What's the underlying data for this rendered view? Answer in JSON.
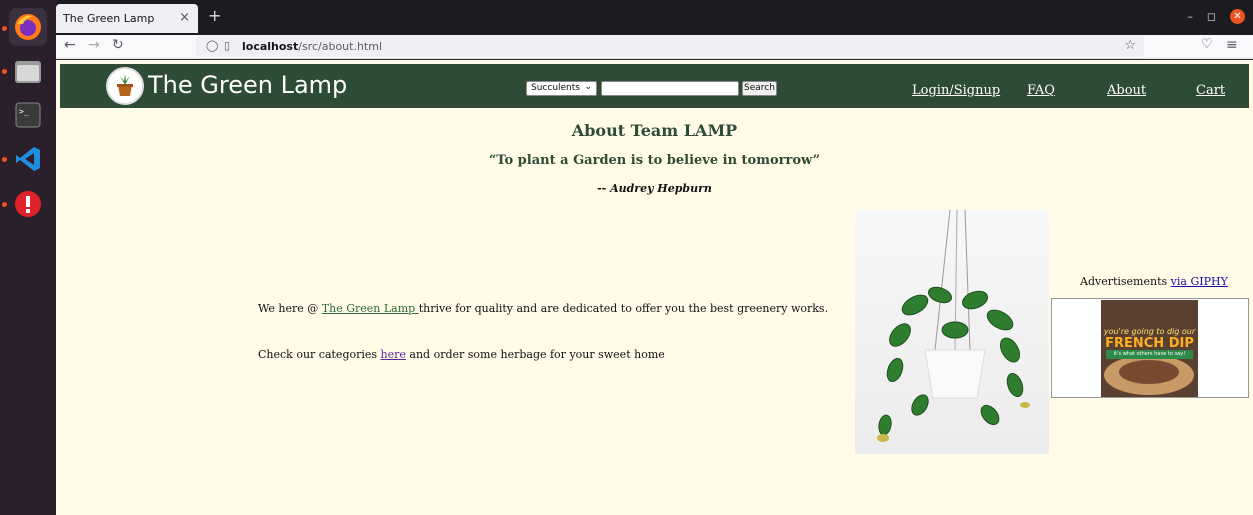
{
  "browser": {
    "tab_title": "The Green Lamp",
    "tab_close": "×",
    "new_tab": "+",
    "url_host": "localhost",
    "url_path": "/src/about.html"
  },
  "site": {
    "title": "The Green Lamp",
    "category_selected": "Succulents",
    "search_button": "Search",
    "nav": [
      "Login/Signup",
      "FAQ",
      "About",
      "Cart"
    ]
  },
  "about": {
    "title": "About Team LAMP",
    "quote": "“To plant a Garden is to believe in tomorrow”",
    "author": "-- Audrey Hepburn",
    "para1_before": "We here @ ",
    "para1_link": "The Green Lamp ",
    "para1_after": "thrive for quality and are dedicated to offer you the best greenery works.",
    "para2_before": "Check our categories ",
    "para2_link": "here",
    "para2_after": " and order some herbage for your sweet home"
  },
  "ads": {
    "label": "Advertisements ",
    "link": "via GIPHY",
    "ad_line1": "you're going to dig our",
    "ad_line2": "FRENCH DIP",
    "ad_line3": "it's what others have to say!"
  },
  "colors": {
    "header_bg": "#2e4b36",
    "page_bg": "#fffbe6",
    "accent": "#e95420"
  }
}
